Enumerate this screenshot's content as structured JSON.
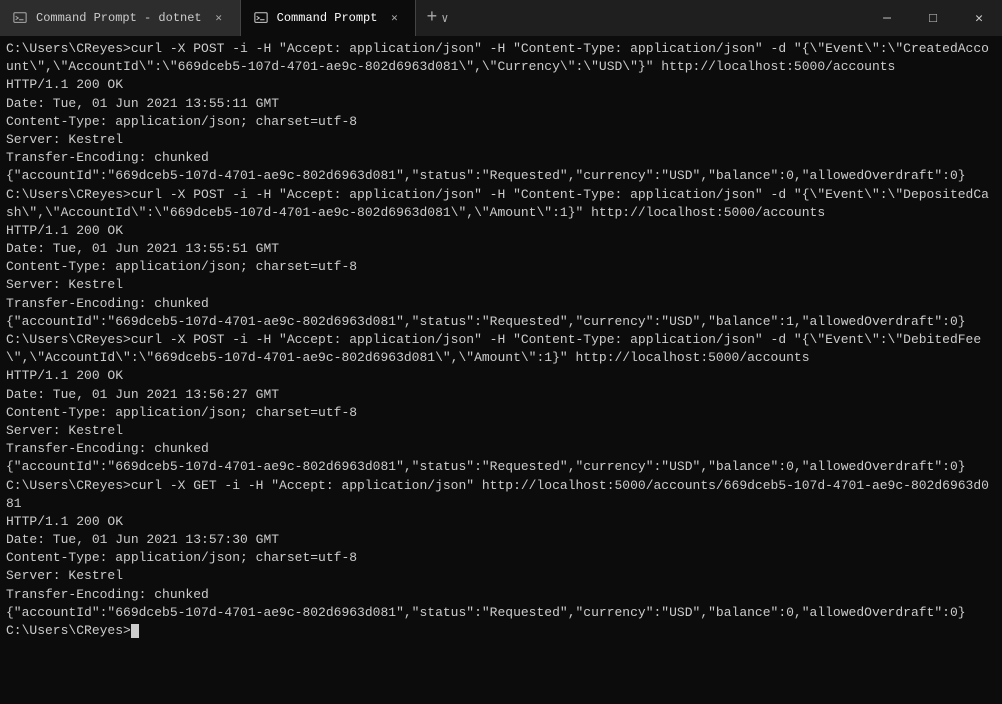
{
  "titlebar": {
    "tabs": [
      {
        "id": "tab1",
        "label": "Command Prompt - dotnet",
        "active": false,
        "closeable": true
      },
      {
        "id": "tab2",
        "label": "Command Prompt",
        "active": true,
        "closeable": true
      }
    ],
    "new_tab_label": "+",
    "chevron_label": "∨",
    "minimize_label": "─",
    "maximize_label": "□",
    "close_label": "✕"
  },
  "terminal": {
    "lines": [
      "C:\\Users\\CReyes>curl -X POST -i -H \"Accept: application/json\" -H \"Content-Type: application/json\" -d \"{\\\"Event\\\":\\\"CreatedAccount\\\",\\\"AccountId\\\":\\\"669dceb5-107d-4701-ae9c-802d6963d081\\\",\\\"Currency\\\":\\\"USD\\\"}\" http://localhost:5000/accounts",
      "HTTP/1.1 200 OK",
      "Date: Tue, 01 Jun 2021 13:55:11 GMT",
      "Content-Type: application/json; charset=utf-8",
      "Server: Kestrel",
      "Transfer-Encoding: chunked",
      "",
      "{\"accountId\":\"669dceb5-107d-4701-ae9c-802d6963d081\",\"status\":\"Requested\",\"currency\":\"USD\",\"balance\":0,\"allowedOverdraft\":0}",
      "C:\\Users\\CReyes>curl -X POST -i -H \"Accept: application/json\" -H \"Content-Type: application/json\" -d \"{\\\"Event\\\":\\\"DepositedCash\\\",\\\"AccountId\\\":\\\"669dceb5-107d-4701-ae9c-802d6963d081\\\",\\\"Amount\\\":1}\" http://localhost:5000/accounts",
      "HTTP/1.1 200 OK",
      "Date: Tue, 01 Jun 2021 13:55:51 GMT",
      "Content-Type: application/json; charset=utf-8",
      "Server: Kestrel",
      "Transfer-Encoding: chunked",
      "",
      "{\"accountId\":\"669dceb5-107d-4701-ae9c-802d6963d081\",\"status\":\"Requested\",\"currency\":\"USD\",\"balance\":1,\"allowedOverdraft\":0}",
      "C:\\Users\\CReyes>curl -X POST -i -H \"Accept: application/json\" -H \"Content-Type: application/json\" -d \"{\\\"Event\\\":\\\"DebitedFee\\\",\\\"AccountId\\\":\\\"669dceb5-107d-4701-ae9c-802d6963d081\\\",\\\"Amount\\\":1}\" http://localhost:5000/accounts",
      "HTTP/1.1 200 OK",
      "Date: Tue, 01 Jun 2021 13:56:27 GMT",
      "Content-Type: application/json; charset=utf-8",
      "Server: Kestrel",
      "Transfer-Encoding: chunked",
      "",
      "{\"accountId\":\"669dceb5-107d-4701-ae9c-802d6963d081\",\"status\":\"Requested\",\"currency\":\"USD\",\"balance\":0,\"allowedOverdraft\":0}",
      "C:\\Users\\CReyes>curl -X GET -i -H \"Accept: application/json\" http://localhost:5000/accounts/669dceb5-107d-4701-ae9c-802d6963d081",
      "HTTP/1.1 200 OK",
      "Date: Tue, 01 Jun 2021 13:57:30 GMT",
      "Content-Type: application/json; charset=utf-8",
      "Server: Kestrel",
      "Transfer-Encoding: chunked",
      "",
      "{\"accountId\":\"669dceb5-107d-4701-ae9c-802d6963d081\",\"status\":\"Requested\",\"currency\":\"USD\",\"balance\":0,\"allowedOverdraft\":0}",
      "C:\\Users\\CReyes>"
    ]
  }
}
